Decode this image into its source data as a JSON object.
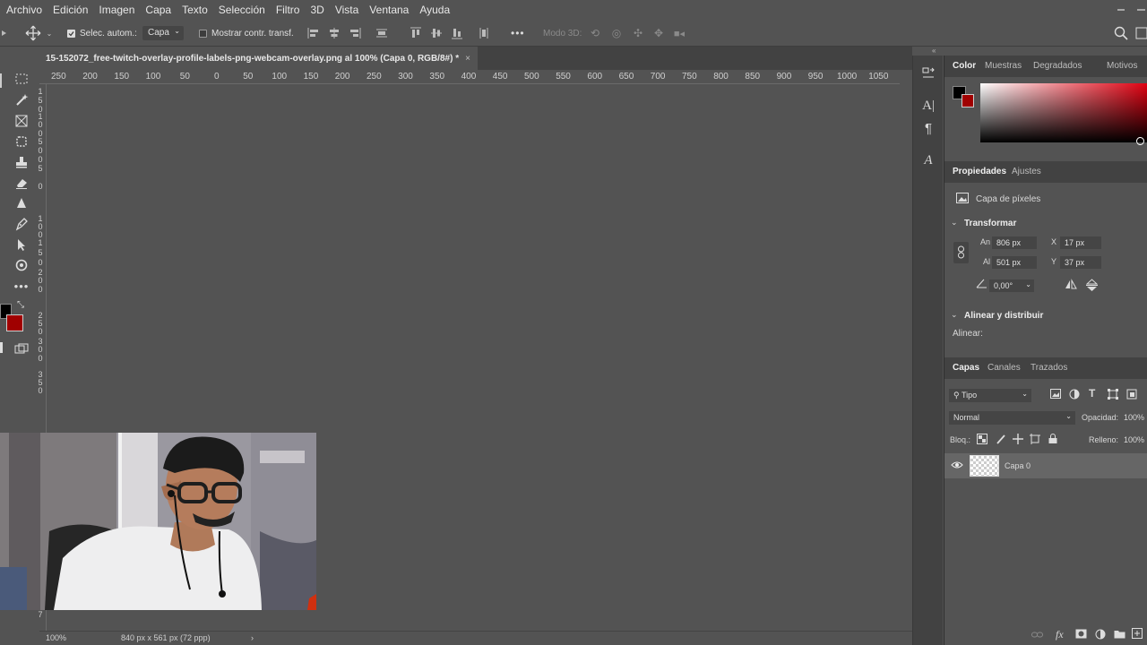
{
  "menubar": {
    "items": [
      "Archivo",
      "Edición",
      "Imagen",
      "Capa",
      "Texto",
      "Selección",
      "Filtro",
      "3D",
      "Vista",
      "Ventana",
      "Ayuda"
    ]
  },
  "options": {
    "auto_select_label": "Selec. autom.:",
    "auto_select_checked": true,
    "layer_select_value": "Capa",
    "show_transform_label": "Mostrar contr. transf.",
    "show_transform_checked": false,
    "more_label": "•••",
    "mode3d_label": "Modo 3D:"
  },
  "document": {
    "tab_title": "15-152072_free-twitch-overlay-profile-labels-png-webcam-overlay.png al 100% (Capa 0, RGB/8#) *",
    "close_glyph": "×"
  },
  "ruler": {
    "h_labels": [
      "250",
      "200",
      "150",
      "100",
      "50",
      "0",
      "50",
      "100",
      "150",
      "200",
      "250",
      "300",
      "350",
      "400",
      "450",
      "500",
      "550",
      "600",
      "650",
      "700",
      "750",
      "800",
      "850",
      "900",
      "950",
      "1000",
      "1050"
    ],
    "v_labels": [
      "1",
      "5",
      "0",
      "1",
      "0",
      "0",
      "5",
      "0",
      "0",
      "5",
      "0",
      "1",
      "0",
      "0",
      "1",
      "5",
      "0",
      "2",
      "0",
      "0",
      "2",
      "5",
      "0",
      "3",
      "0",
      "0",
      "3",
      "5",
      "0",
      "0",
      "7"
    ]
  },
  "status": {
    "zoom": "100%",
    "doc_info": "840 px x 561 px (72 ppp)",
    "arrow": "›"
  },
  "color_panel": {
    "tabs": [
      "Color",
      "Muestras",
      "Degradados",
      "Motivos"
    ],
    "active_tab": "Color",
    "foreground": "#000000",
    "background": "#a00000"
  },
  "properties": {
    "tabs": [
      "Propiedades",
      "Ajustes"
    ],
    "layer_type": "Capa de píxeles",
    "transform_header": "Transformar",
    "w_label": "An",
    "w_value": "806 px",
    "h_label": "Al",
    "h_value": "501 px",
    "x_label": "X",
    "x_value": "17 px",
    "y_label": "Y",
    "y_value": "37 px",
    "angle_value": "0,00°",
    "align_header": "Alinear y distribuir",
    "align_label": "Alinear:"
  },
  "layers": {
    "tabs": [
      "Capas",
      "Canales",
      "Trazados"
    ],
    "filter_value": "Tipo",
    "blend_mode": "Normal",
    "opacity_label": "Opacidad:",
    "opacity_value": "100%",
    "lock_label": "Bloq.:",
    "fill_label": "Relleno:",
    "fill_value": "100%",
    "items": [
      {
        "name": "Capa 0",
        "visible": true
      }
    ]
  },
  "colors": {
    "accent_red": "#a00000",
    "ui_bg": "#535353",
    "panel_dark": "#424242"
  }
}
